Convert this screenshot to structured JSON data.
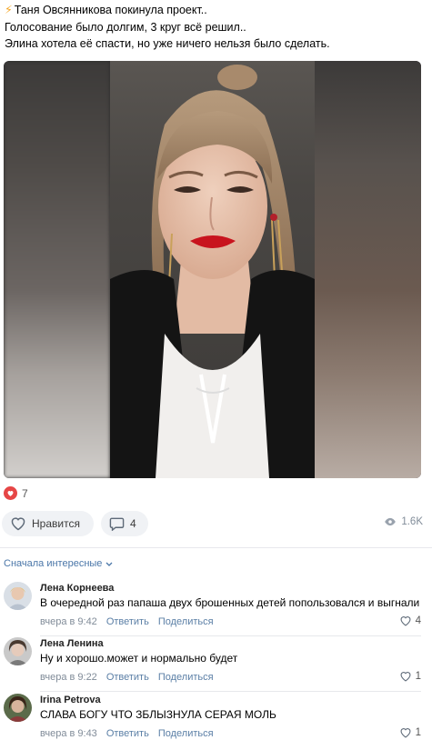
{
  "post": {
    "line1": "Таня Овсянникова покинула проект..",
    "line2": "Голосование было долгим, 3 круг всё решил..",
    "line3": "Элина хотела её спасти, но уже ничего нельзя было сделать."
  },
  "reactions": {
    "count": "7"
  },
  "actions": {
    "like_label": "Нравится",
    "comments_count": "4",
    "views": "1.6K"
  },
  "comments_header": {
    "sort_label": "Сначала интересные"
  },
  "comments": [
    {
      "author": "Лена Корнеева",
      "text": "В очередной раз папаша двух брошенных детей попользовался и выгнали",
      "time": "вчера в 9:42",
      "reply": "Ответить",
      "share": "Поделиться",
      "likes": "4"
    },
    {
      "author": "Лена Ленина",
      "text": "Ну и хорошо.может и нормально будет",
      "time": "вчера в 9:22",
      "reply": "Ответить",
      "share": "Поделиться",
      "likes": "1"
    },
    {
      "author": "Irina Petrova",
      "text": "СЛАВА БОГУ ЧТО ЗБЛЫЗНУЛА СЕРАЯ МОЛЬ",
      "time": "вчера в 9:43",
      "reply": "Ответить",
      "share": "Поделиться",
      "likes": "1"
    }
  ]
}
